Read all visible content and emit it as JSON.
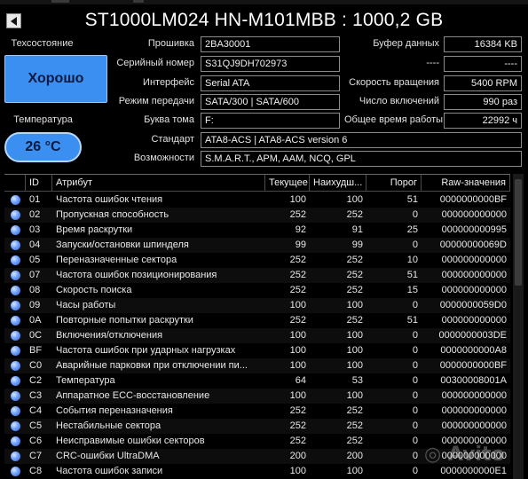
{
  "drive": {
    "title": "ST1000LM024 HN-M101MBB : 1000,2 GB"
  },
  "health": {
    "label": "Техсостояние",
    "value": "Хорошо",
    "color": "#3a8ff0"
  },
  "temperature": {
    "label": "Температура",
    "value": "26 °C"
  },
  "info": {
    "firmware": {
      "label": "Прошивка",
      "value": "2BA30001"
    },
    "serial": {
      "label": "Серийный номер",
      "value": "S31QJ9DH702973"
    },
    "interface": {
      "label": "Интерфейс",
      "value": "Serial ATA"
    },
    "transfer": {
      "label": "Режим передачи",
      "value": "SATA/300 | SATA/600"
    },
    "volume": {
      "label": "Буква тома",
      "value": "F:"
    },
    "standard": {
      "label": "Стандарт",
      "value": "ATA8-ACS | ATA8-ACS version 6"
    },
    "features": {
      "label": "Возможности",
      "value": "S.M.A.R.T., APM, AAM, NCQ, GPL"
    },
    "buffer": {
      "label": "Буфер данных",
      "value": "16384 KB"
    },
    "blank_left": "----",
    "blank_right": "----",
    "rotation": {
      "label": "Скорость вращения",
      "value": "5400 RPM"
    },
    "power_count": {
      "label": "Число включений",
      "value": "990 раз"
    },
    "power_hours": {
      "label": "Общее время работы",
      "value": "22992 ч"
    }
  },
  "table": {
    "headers": [
      "ID",
      "Атрибут",
      "Текущее",
      "Наихудш...",
      "Порог",
      "Raw-значения"
    ],
    "rows": [
      [
        "01",
        "Частота ошибок чтения",
        "100",
        "100",
        "51",
        "0000000000BF"
      ],
      [
        "02",
        "Пропускная способность",
        "252",
        "252",
        "0",
        "000000000000"
      ],
      [
        "03",
        "Время раскрутки",
        "92",
        "91",
        "25",
        "000000000995"
      ],
      [
        "04",
        "Запуски/остановки шпинделя",
        "99",
        "99",
        "0",
        "00000000069D"
      ],
      [
        "05",
        "Переназначенные сектора",
        "252",
        "252",
        "10",
        "000000000000"
      ],
      [
        "07",
        "Частота ошибок позиционирования",
        "252",
        "252",
        "51",
        "000000000000"
      ],
      [
        "08",
        "Скорость поиска",
        "252",
        "252",
        "15",
        "000000000000"
      ],
      [
        "09",
        "Часы работы",
        "100",
        "100",
        "0",
        "0000000059D0"
      ],
      [
        "0A",
        "Повторные попытки раскрутки",
        "252",
        "252",
        "51",
        "000000000000"
      ],
      [
        "0C",
        "Включения/отключения",
        "100",
        "100",
        "0",
        "0000000003DE"
      ],
      [
        "BF",
        "Частота ошибок при ударных нагрузках",
        "100",
        "100",
        "0",
        "0000000000A8"
      ],
      [
        "C0",
        "Аварийные парковки при отключении пи...",
        "100",
        "100",
        "0",
        "0000000000BF"
      ],
      [
        "C2",
        "Температура",
        "64",
        "53",
        "0",
        "00300008001A"
      ],
      [
        "C3",
        "Аппаратное ECC-восстановление",
        "100",
        "100",
        "0",
        "000000000000"
      ],
      [
        "C4",
        "События переназначения",
        "252",
        "252",
        "0",
        "000000000000"
      ],
      [
        "C5",
        "Нестабильные сектора",
        "252",
        "252",
        "0",
        "000000000000"
      ],
      [
        "C6",
        "Неисправимые ошибки секторов",
        "252",
        "252",
        "0",
        "000000000000"
      ],
      [
        "C7",
        "CRC-ошибки UltraDMA",
        "200",
        "200",
        "0",
        "000000000000"
      ],
      [
        "C8",
        "Частота ошибок записи",
        "100",
        "100",
        "0",
        "0000000000E1"
      ]
    ]
  },
  "status_dot_color": "#4f80e8",
  "icons": {
    "back": "back-arrow-icon",
    "status": "status-dot-icon"
  }
}
